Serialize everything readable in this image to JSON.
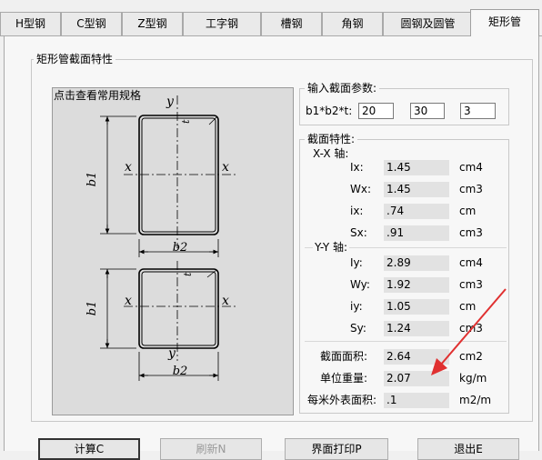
{
  "tabs": [
    {
      "label": "H型钢"
    },
    {
      "label": "C型钢"
    },
    {
      "label": "Z型钢"
    },
    {
      "label": "工字钢"
    },
    {
      "label": "槽钢"
    },
    {
      "label": "角钢"
    },
    {
      "label": "圆钢及圆管"
    },
    {
      "label": "矩形管"
    }
  ],
  "section_group": {
    "title": "矩形管截面特性"
  },
  "drawing": {
    "caption": "点击查看常用规格",
    "labels": {
      "x": "x",
      "y": "y",
      "t": "t",
      "b1": "b1",
      "b2": "b2"
    }
  },
  "input_group": {
    "title": "输入截面参数:",
    "prompt": "b1*b2*t:",
    "b1": "20",
    "b2": "30",
    "t": "3"
  },
  "props_group": {
    "title": "截面特性:",
    "xx_axis": "X-X 轴:",
    "yy_axis": "Y-Y 轴:",
    "xx": [
      {
        "name": "Ix:",
        "value": "1.45",
        "unit": "cm4"
      },
      {
        "name": "Wx:",
        "value": "1.45",
        "unit": "cm3"
      },
      {
        "name": "ix:",
        "value": ".74",
        "unit": "cm"
      },
      {
        "name": "Sx:",
        "value": ".91",
        "unit": "cm3"
      }
    ],
    "yy": [
      {
        "name": "Iy:",
        "value": "2.89",
        "unit": "cm4"
      },
      {
        "name": "Wy:",
        "value": "1.92",
        "unit": "cm3"
      },
      {
        "name": "iy:",
        "value": "1.05",
        "unit": "cm"
      },
      {
        "name": "Sy:",
        "value": "1.24",
        "unit": "cm3"
      }
    ],
    "other": [
      {
        "name": "截面面积:",
        "value": "2.64",
        "unit": "cm2"
      },
      {
        "name": "单位重量:",
        "value": "2.07",
        "unit": "kg/m"
      },
      {
        "name": "每米外表面积:",
        "value": ".1",
        "unit": "m2/m"
      }
    ]
  },
  "buttons": {
    "calc": "计算C",
    "refresh": "刷新N",
    "print": "界面打印P",
    "exit": "退出E"
  },
  "colors": {
    "arrow": "#e03030"
  }
}
